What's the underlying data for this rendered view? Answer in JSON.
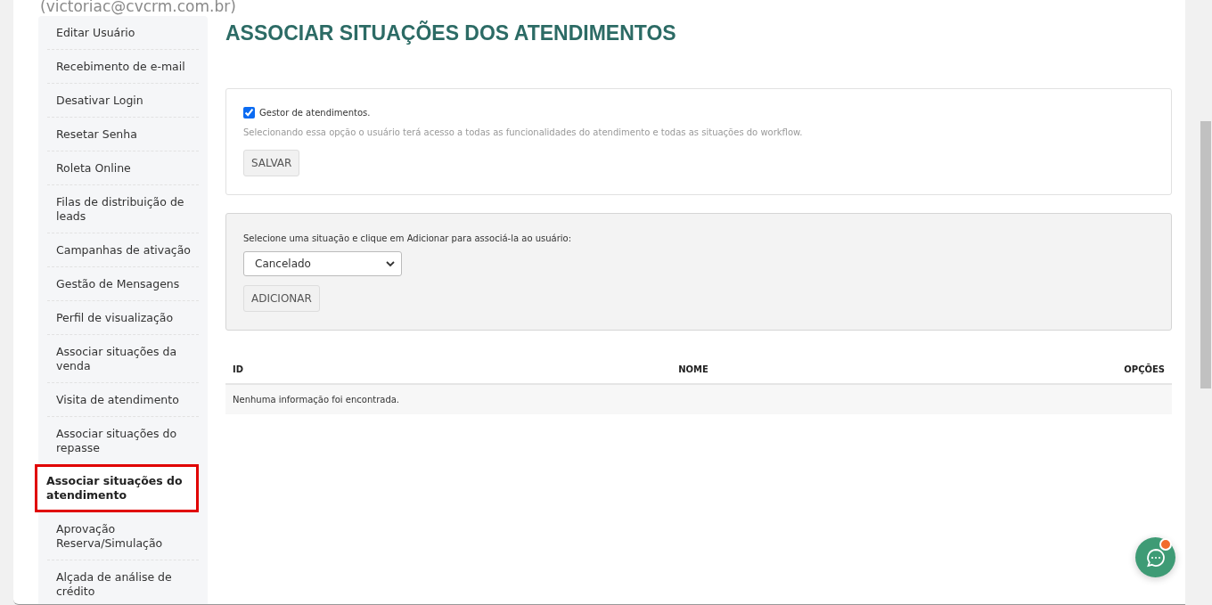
{
  "header": {
    "email": "(victoriac@cvcrm.com.br)"
  },
  "sidebar": {
    "items": [
      {
        "label": "Editar Usuário",
        "selected": false
      },
      {
        "label": "Recebimento de e-mail",
        "selected": false
      },
      {
        "label": "Desativar Login",
        "selected": false
      },
      {
        "label": "Resetar Senha",
        "selected": false
      },
      {
        "label": "Roleta Online",
        "selected": false
      },
      {
        "label": "Filas de distribuição de leads",
        "selected": false
      },
      {
        "label": "Campanhas de ativação",
        "selected": false
      },
      {
        "label": "Gestão de Mensagens",
        "selected": false
      },
      {
        "label": "Perfil de visualização",
        "selected": false
      },
      {
        "label": "Associar situações da venda",
        "selected": false
      },
      {
        "label": "Visita de atendimento",
        "selected": false
      },
      {
        "label": "Associar situações do repasse",
        "selected": false
      },
      {
        "label": "Associar situações do atendimento",
        "selected": true
      },
      {
        "label": "Aprovação Reserva/Simulação",
        "selected": false
      },
      {
        "label": "Alçada de análise de crédito",
        "selected": false
      }
    ]
  },
  "page_title": "ASSOCIAR SITUAÇÕES DOS ATENDIMENTOS",
  "manager_panel": {
    "checkbox": {
      "label": "Gestor de atendimentos.",
      "checked": true
    },
    "help": "Selecionando essa opção o usuário terá acesso a todas as funcionalidades do atendimento e todas as situações do workflow.",
    "button": "SALVAR"
  },
  "add_panel": {
    "instruction": "Selecione uma situação e clique em Adicionar para associá-la ao usuário:",
    "select_value": "Cancelado",
    "button": "ADICIONAR"
  },
  "table": {
    "columns": [
      "ID",
      "NOME",
      "OPÇÕES"
    ],
    "empty_message": "Nenhuma informação foi encontrada."
  }
}
